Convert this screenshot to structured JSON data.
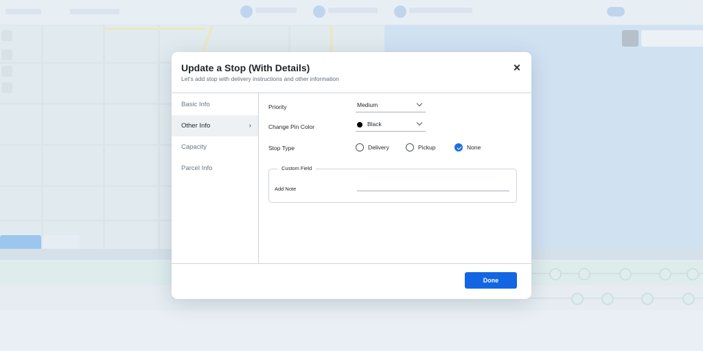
{
  "modal": {
    "title": "Update a Stop (With Details)",
    "subtitle": "Let's add stop with delivery instructions and other information",
    "close_icon": "close-icon",
    "nav": [
      {
        "label": "Basic Info",
        "active": false
      },
      {
        "label": "Other Info",
        "active": true
      },
      {
        "label": "Capacity",
        "active": false
      },
      {
        "label": "Parcel Info",
        "active": false
      }
    ],
    "priority": {
      "label": "Priority",
      "value": "Medium"
    },
    "pin_color": {
      "label": "Change Pin Color",
      "value": "Black",
      "swatch": "#000000"
    },
    "stop_type": {
      "label": "Stop Type",
      "options": [
        "Delivery",
        "Pickup",
        "None"
      ],
      "selected": "None"
    },
    "custom_field": {
      "legend": "Custom Field",
      "note_label": "Add Note",
      "note_value": ""
    },
    "done_label": "Done"
  },
  "colors": {
    "accent": "#1266e2",
    "radio_checked": "#1b6fe0",
    "map_water": "#bcd6ee",
    "map_land": "#dbe7ea"
  }
}
